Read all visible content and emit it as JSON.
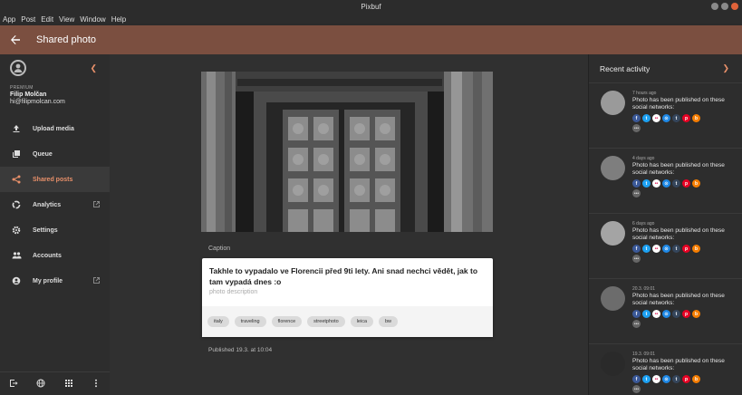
{
  "window": {
    "title": "Pixbuf"
  },
  "menu": [
    "App",
    "Post",
    "Edit",
    "View",
    "Window",
    "Help"
  ],
  "appbar": {
    "title": "Shared photo"
  },
  "sidebar": {
    "tier": "PREMIUM",
    "name": "Filip Molčan",
    "email": "hi@filipmolcan.com",
    "items": [
      {
        "label": "Upload media",
        "icon": "upload-icon"
      },
      {
        "label": "Queue",
        "icon": "queue-icon"
      },
      {
        "label": "Shared posts",
        "icon": "share-icon"
      },
      {
        "label": "Analytics",
        "icon": "analytics-icon"
      },
      {
        "label": "Settings",
        "icon": "gear-icon"
      },
      {
        "label": "Accounts",
        "icon": "people-icon"
      },
      {
        "label": "My profile",
        "icon": "account-icon"
      }
    ]
  },
  "post": {
    "caption_label": "Caption",
    "caption": "Takhle to vypadalo ve Florencii před 9ti lety. Ani snad nechci vědět, jak to tam vypadá dnes :o",
    "description_placeholder": "photo description",
    "tags": [
      "italy",
      "traveling",
      "florence",
      "streetphoto",
      "leica",
      "bw"
    ],
    "published": "Published 19.3. at 10:04"
  },
  "activity": {
    "title": "Recent activity",
    "items": [
      {
        "time": "7 hours ago",
        "text": "Photo has been published on these social networks:"
      },
      {
        "time": "4 days ago",
        "text": "Photo has been published on these social networks:"
      },
      {
        "time": "6 days ago",
        "text": "Photo has been published on these social networks:"
      },
      {
        "time": "20.3. 09:01",
        "text": "Photo has been published on these social networks:"
      },
      {
        "time": "19.3. 09:01",
        "text": "Photo has been published on these social networks:"
      }
    ],
    "networks": [
      {
        "glyph": "f",
        "color": "#3b5998",
        "icon": "facebook-icon"
      },
      {
        "glyph": "t",
        "color": "#1da1f2",
        "icon": "twitter-icon"
      },
      {
        "glyph": "••",
        "color": "#ffffff",
        "icon": "flickr-icon"
      },
      {
        "glyph": "⊙",
        "color": "#1e88e5",
        "icon": "500px-icon"
      },
      {
        "glyph": "t",
        "color": "#35465c",
        "icon": "tumblr-icon"
      },
      {
        "glyph": "p",
        "color": "#e60023",
        "icon": "pinterest-icon"
      },
      {
        "glyph": "b",
        "color": "#f57d00",
        "icon": "blogger-icon"
      }
    ]
  },
  "colors": {
    "accent": "#e8906a",
    "appbar": "#7b4f40"
  }
}
